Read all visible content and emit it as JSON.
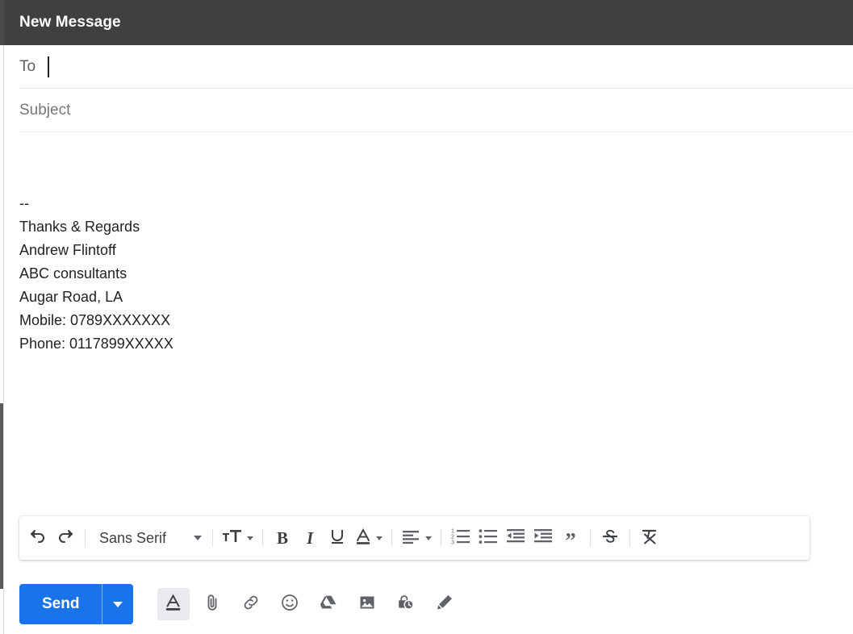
{
  "window": {
    "title": "New Message",
    "header_bg": "#404040",
    "accent": "#1a73e8"
  },
  "fields": {
    "to": {
      "label": "To",
      "value": "",
      "placeholder": "",
      "has_cursor": true
    },
    "subject": {
      "label": "Subject",
      "value": "",
      "placeholder": "Subject"
    }
  },
  "body": {
    "lines": [
      "--",
      "Thanks & Regards",
      "Andrew Flintoff",
      "ABC consultants",
      "Augar Road, LA",
      "Mobile: 0789XXXXXXX",
      "Phone: 0117899XXXXX"
    ]
  },
  "format_toolbar": {
    "undo": {
      "label": "Undo",
      "icon": "undo-icon"
    },
    "redo": {
      "label": "Redo",
      "icon": "redo-icon"
    },
    "font": {
      "label": "Sans Serif",
      "icon": "chevron-down-icon"
    },
    "font_size": {
      "label": "Font size",
      "icon": "font-size-icon"
    },
    "bold": {
      "label": "B",
      "icon": "bold-icon"
    },
    "italic": {
      "label": "I",
      "icon": "italic-icon"
    },
    "underline": {
      "label": "U",
      "icon": "underline-icon"
    },
    "text_color": {
      "label": "A",
      "icon": "text-color-icon"
    },
    "align": {
      "label": "Align",
      "icon": "align-left-icon"
    },
    "numbered_list": {
      "label": "Numbered list",
      "icon": "numbered-list-icon"
    },
    "bulleted_list": {
      "label": "Bulleted list",
      "icon": "bulleted-list-icon"
    },
    "indent_less": {
      "label": "Indent less",
      "icon": "indent-decrease-icon"
    },
    "indent_more": {
      "label": "Indent more",
      "icon": "indent-increase-icon"
    },
    "quote": {
      "label": "”",
      "icon": "block-quote-icon"
    },
    "strikethrough": {
      "label": "Strikethrough",
      "icon": "strikethrough-icon"
    },
    "remove_format": {
      "label": "Remove formatting",
      "icon": "remove-formatting-icon"
    }
  },
  "action_bar": {
    "send": {
      "label": "Send",
      "caret": "send-options-caret"
    },
    "icons": [
      {
        "name": "formatting-options-icon",
        "label": "Formatting options",
        "active": true
      },
      {
        "name": "attach-file-icon",
        "label": "Attach files",
        "active": false
      },
      {
        "name": "insert-link-icon",
        "label": "Insert link",
        "active": false
      },
      {
        "name": "insert-emoji-icon",
        "label": "Insert emoji",
        "active": false
      },
      {
        "name": "insert-drive-icon",
        "label": "Insert files using Drive",
        "active": false
      },
      {
        "name": "insert-photo-icon",
        "label": "Insert photo",
        "active": false
      },
      {
        "name": "confidential-mode-icon",
        "label": "Toggle confidential mode",
        "active": false
      },
      {
        "name": "insert-signature-icon",
        "label": "Insert signature",
        "active": false
      }
    ]
  }
}
